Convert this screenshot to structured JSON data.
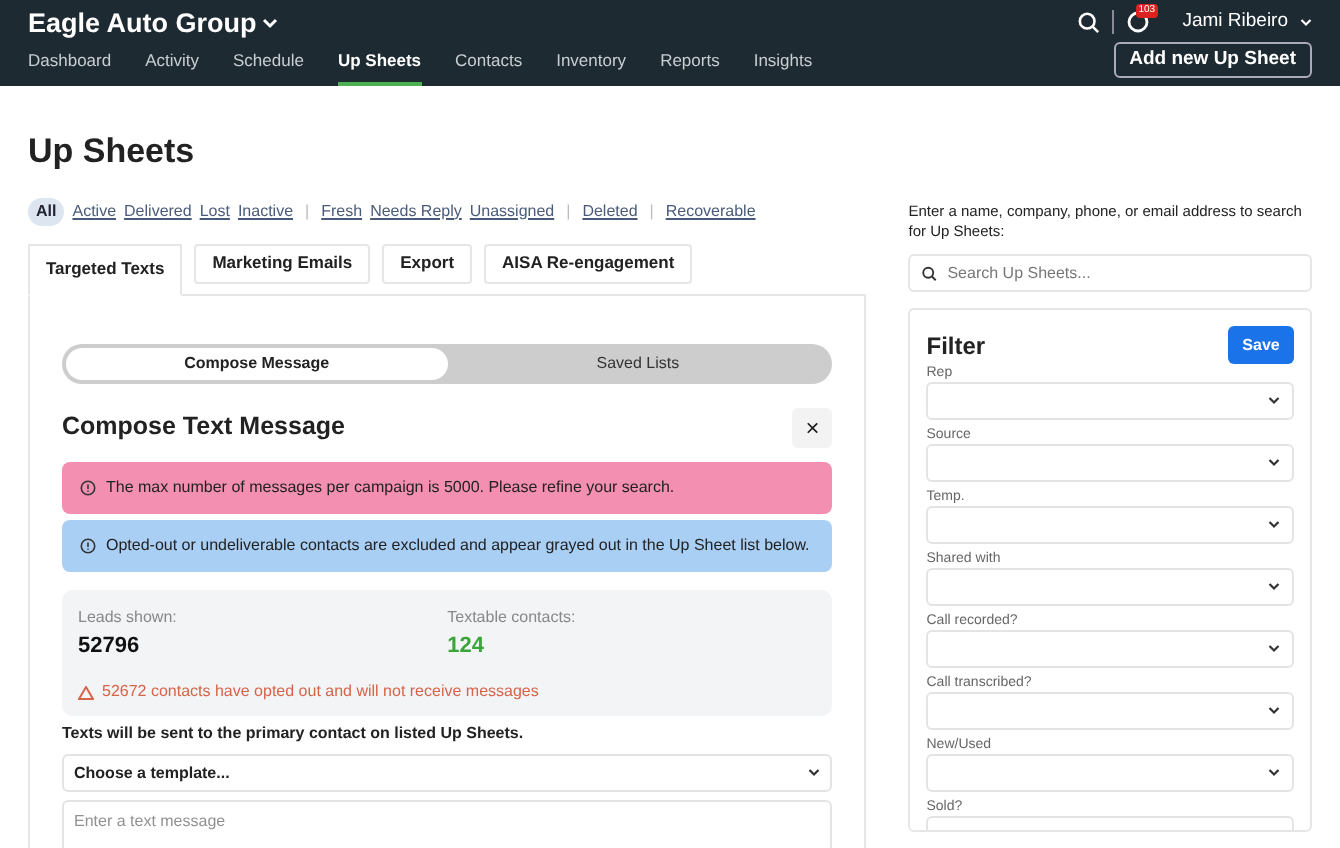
{
  "header": {
    "brand": "Eagle Auto Group",
    "nav": [
      {
        "label": "Dashboard",
        "selected": false
      },
      {
        "label": "Activity",
        "selected": false
      },
      {
        "label": "Schedule",
        "selected": false
      },
      {
        "label": "Up Sheets",
        "selected": true
      },
      {
        "label": "Contacts",
        "selected": false
      },
      {
        "label": "Inventory",
        "selected": false
      },
      {
        "label": "Reports",
        "selected": false
      },
      {
        "label": "Insights",
        "selected": false
      }
    ],
    "notification_count": "103",
    "user": "Jami Ribeiro",
    "add_button": "Add new Up Sheet"
  },
  "page_title": "Up Sheets",
  "quick_filters": [
    {
      "kind": "link",
      "label": "All",
      "selected": true
    },
    {
      "kind": "link",
      "label": "Active",
      "selected": false
    },
    {
      "kind": "link",
      "label": "Delivered",
      "selected": false
    },
    {
      "kind": "link",
      "label": "Lost",
      "selected": false
    },
    {
      "kind": "link",
      "label": "Inactive",
      "selected": false
    },
    {
      "kind": "separator",
      "label": "|"
    },
    {
      "kind": "link",
      "label": "Fresh",
      "selected": false
    },
    {
      "kind": "link",
      "label": "Needs Reply",
      "selected": false
    },
    {
      "kind": "link",
      "label": "Unassigned",
      "selected": false
    },
    {
      "kind": "separator",
      "label": "|"
    },
    {
      "kind": "link",
      "label": "Deleted",
      "selected": false
    },
    {
      "kind": "separator",
      "label": "|"
    },
    {
      "kind": "link",
      "label": "Recoverable",
      "selected": false
    }
  ],
  "tabs": [
    {
      "label": "Targeted Texts",
      "selected": true
    },
    {
      "label": "Marketing Emails",
      "selected": false
    },
    {
      "label": "Export",
      "selected": false
    },
    {
      "label": "AISA Re-engagement",
      "selected": false
    }
  ],
  "compose": {
    "toggle": [
      {
        "label": "Compose Message",
        "selected": true
      },
      {
        "label": "Saved Lists",
        "selected": false
      }
    ],
    "title": "Compose Text Message",
    "close": "×",
    "alerts": [
      {
        "kind": "error",
        "text": "The max number of messages per campaign is 5000. Please refine your search."
      },
      {
        "kind": "info",
        "text": "Opted-out or undeliverable contacts are excluded and appear grayed out in the Up Sheet list below."
      }
    ],
    "stats": [
      {
        "kind": "neutral",
        "label": "Leads shown:",
        "value": "52796"
      },
      {
        "kind": "success",
        "label": "Textable contacts:",
        "value": "124"
      }
    ],
    "warning": "52672 contacts have opted out and will not receive messages",
    "note": "Texts will be sent to the primary contact on listed Up Sheets.",
    "template_select": "Choose a template...",
    "message_placeholder": "Enter a text message"
  },
  "search": {
    "hint": "Enter a name, company, phone, or email address to search for Up Sheets:",
    "placeholder": "Search Up Sheets..."
  },
  "filter": {
    "title": "Filter",
    "save": "Save",
    "fields": [
      {
        "label": "Rep"
      },
      {
        "label": "Source"
      },
      {
        "label": "Temp."
      },
      {
        "label": "Shared with"
      },
      {
        "label": "Call recorded?"
      },
      {
        "label": "Call transcribed?"
      },
      {
        "label": "New/Used"
      },
      {
        "label": "Sold?"
      }
    ]
  }
}
